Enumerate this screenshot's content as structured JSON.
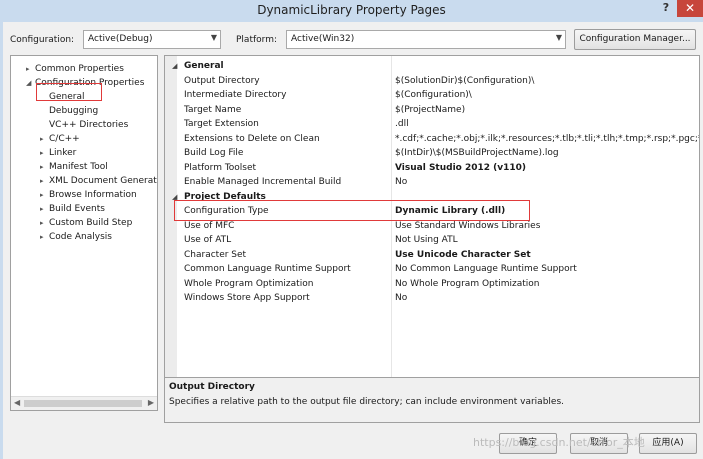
{
  "window": {
    "title": "DynamicLibrary Property Pages",
    "help": "?",
    "close": "✕"
  },
  "toolbar": {
    "configuration_label": "Configuration:",
    "configuration_value": "Active(Debug)",
    "platform_label": "Platform:",
    "platform_value": "Active(Win32)",
    "config_manager_label": "Configuration Manager..."
  },
  "tree": [
    {
      "label": "Common Properties",
      "twisty": "▸"
    },
    {
      "label": "Configuration Properties",
      "twisty": "◢"
    },
    {
      "label": "General",
      "twisty": ""
    },
    {
      "label": "Debugging",
      "twisty": ""
    },
    {
      "label": "VC++ Directories",
      "twisty": ""
    },
    {
      "label": "C/C++",
      "twisty": "▸"
    },
    {
      "label": "Linker",
      "twisty": "▸"
    },
    {
      "label": "Manifest Tool",
      "twisty": "▸"
    },
    {
      "label": "XML Document Generat",
      "twisty": "▸"
    },
    {
      "label": "Browse Information",
      "twisty": "▸"
    },
    {
      "label": "Build Events",
      "twisty": "▸"
    },
    {
      "label": "Custom Build Step",
      "twisty": "▸"
    },
    {
      "label": "Code Analysis",
      "twisty": "▸"
    }
  ],
  "grid": {
    "category_general": "General",
    "category_defaults": "Project Defaults",
    "general_rows": [
      {
        "name": "Output Directory",
        "value": "$(SolutionDir)$(Configuration)\\",
        "bold": false
      },
      {
        "name": "Intermediate Directory",
        "value": "$(Configuration)\\",
        "bold": false
      },
      {
        "name": "Target Name",
        "value": "$(ProjectName)",
        "bold": false
      },
      {
        "name": "Target Extension",
        "value": ".dll",
        "bold": false
      },
      {
        "name": "Extensions to Delete on Clean",
        "value": "*.cdf;*.cache;*.obj;*.ilk;*.resources;*.tlb;*.tli;*.tlh;*.tmp;*.rsp;*.pgc;*.pgd;*.",
        "bold": false
      },
      {
        "name": "Build Log File",
        "value": "$(IntDir)\\$(MSBuildProjectName).log",
        "bold": false
      },
      {
        "name": "Platform Toolset",
        "value": "Visual Studio 2012 (v110)",
        "bold": true
      },
      {
        "name": "Enable Managed Incremental Build",
        "value": "No",
        "bold": false
      }
    ],
    "default_rows": [
      {
        "name": "Configuration Type",
        "value": "Dynamic Library (.dll)",
        "bold": true
      },
      {
        "name": "Use of MFC",
        "value": "Use Standard Windows Libraries",
        "bold": false
      },
      {
        "name": "Use of ATL",
        "value": "Not Using ATL",
        "bold": false
      },
      {
        "name": "Character Set",
        "value": "Use Unicode Character Set",
        "bold": true
      },
      {
        "name": "Common Language Runtime Support",
        "value": "No Common Language Runtime Support",
        "bold": false
      },
      {
        "name": "Whole Program Optimization",
        "value": "No Whole Program Optimization",
        "bold": false
      },
      {
        "name": "Windows Store App Support",
        "value": "No",
        "bold": false
      }
    ]
  },
  "description": {
    "title": "Output Directory",
    "text": "Specifies a relative path to the output file directory; can include environment variables."
  },
  "buttons": {
    "ok": "确定",
    "cancel": "取消",
    "apply": "应用(A)"
  },
  "watermark": "https://blog.csdn.net/error_本地"
}
